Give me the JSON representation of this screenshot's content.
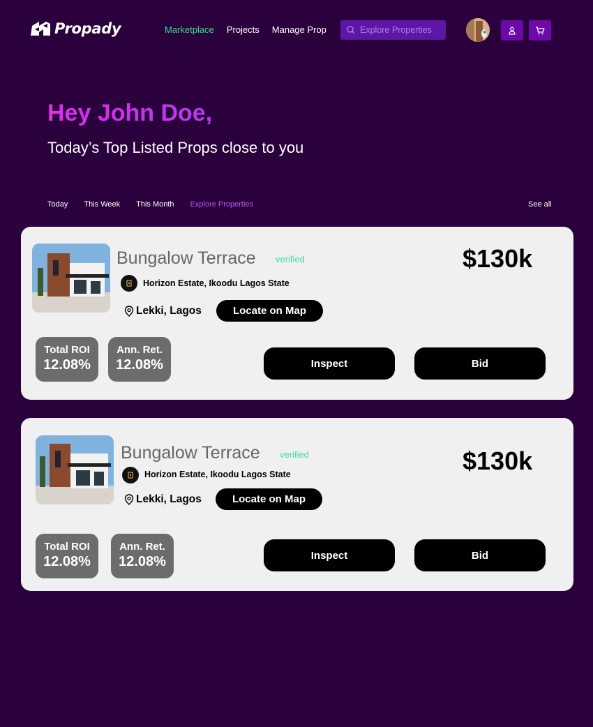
{
  "brand": {
    "name": "Propady"
  },
  "nav": {
    "items": [
      {
        "label": "Marketplace",
        "active": true
      },
      {
        "label": "Projects",
        "active": false
      },
      {
        "label": "Manage Prop",
        "active": false
      }
    ],
    "search_label": "Explore Properties"
  },
  "hero": {
    "greeting": "Hey John Doe,",
    "subtitle": "Today’s Top Listed Props close to you"
  },
  "filters": {
    "tabs": [
      {
        "label": "Today",
        "active": false
      },
      {
        "label": "This Week",
        "active": false
      },
      {
        "label": "This Month",
        "active": false
      },
      {
        "label": "Explore Properties",
        "active": true
      }
    ],
    "see_all": "See all"
  },
  "listings": [
    {
      "name": "Bungalow Terrace",
      "verified": "verified",
      "estate": "Horizon Estate, Ikoodu Lagos State",
      "location": "Lekki, Lagos",
      "map_button": "Locate on Map",
      "price": "$130k",
      "stats": [
        {
          "label": "Total ROI",
          "value": "12.08%"
        },
        {
          "label": "Ann. Ret.",
          "value": "12.08%"
        }
      ],
      "inspect_label": "Inspect",
      "bid_label": "Bid"
    },
    {
      "name": "Bungalow Terrace",
      "verified": "verified",
      "estate": "Horizon Estate, Ikoodu Lagos State",
      "location": "Lekki, Lagos",
      "map_button": "Locate on Map",
      "price": "$130k",
      "stats": [
        {
          "label": "Total ROI",
          "value": "12.08%"
        },
        {
          "label": "Ann. Ret.",
          "value": "12.08%"
        }
      ],
      "inspect_label": "Inspect",
      "bid_label": "Bid"
    }
  ],
  "colors": {
    "background": "#2a013c",
    "accent_green": "#3ddc97",
    "accent_purple": "#b35cf2",
    "card": "#f0f0f0"
  }
}
